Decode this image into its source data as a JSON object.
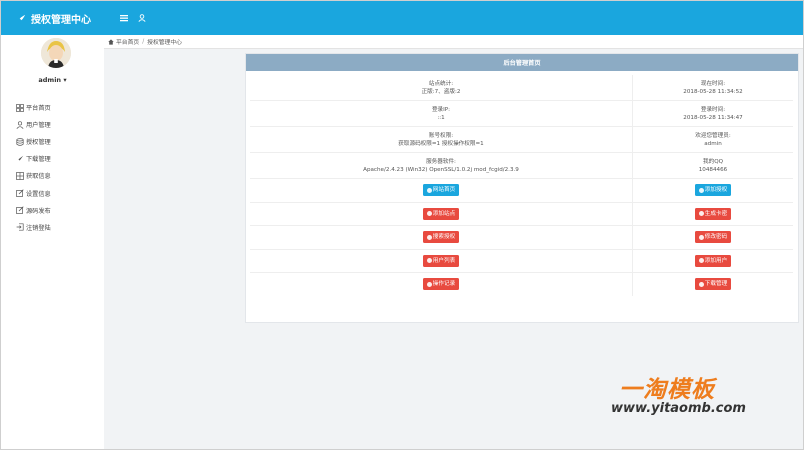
{
  "topbar": {
    "brand": "授权管理中心"
  },
  "user": {
    "name": "admin ▾"
  },
  "nav": [
    {
      "label": "平台首页"
    },
    {
      "label": "用户管理"
    },
    {
      "label": "授权管理"
    },
    {
      "label": "下载管理"
    },
    {
      "label": "获取信息"
    },
    {
      "label": "设置信息"
    },
    {
      "label": "源码发布"
    },
    {
      "label": "注销登陆"
    }
  ],
  "breadcrumb": {
    "home": "平台首页",
    "current": "授权管理中心"
  },
  "panel": {
    "title": "后台管理首页",
    "info": [
      {
        "left_label": "站点统计:",
        "left_value": "正版:7、盗版:2",
        "right_label": "现在时间:",
        "right_value": "2018-05-28 11:34:52"
      },
      {
        "left_label": "登录IP:",
        "left_value": "::1",
        "right_label": "登录时间:",
        "right_value": "2018-05-28 11:34:47"
      },
      {
        "left_label": "账号权限:",
        "left_value": "获取源码权限=1 授权操作权限=1",
        "right_label": "欢迎您管理员:",
        "right_value": "admin"
      },
      {
        "left_label": "服务器软件:",
        "left_value": "Apache/2.4.23 (Win32) OpenSSL/1.0.2j mod_fcgid/2.3.9",
        "right_label": "我的QQ",
        "right_value": "10484466"
      }
    ],
    "buttons": [
      {
        "left": "网站首页",
        "right": "添加授权"
      },
      {
        "left": "添加站点",
        "right": "生成卡密"
      },
      {
        "left": "搜索授权",
        "right": "修改密码"
      },
      {
        "left": "用户列表",
        "right": "添加用户"
      },
      {
        "left": "操作记录",
        "right": "下载管理"
      }
    ]
  },
  "watermark": {
    "title": "一淘模板",
    "url": "www.yitaomb.com"
  },
  "colors": {
    "accent": "#1aa6de",
    "danger": "#e84a3f",
    "panel_head": "#8cabc4"
  }
}
